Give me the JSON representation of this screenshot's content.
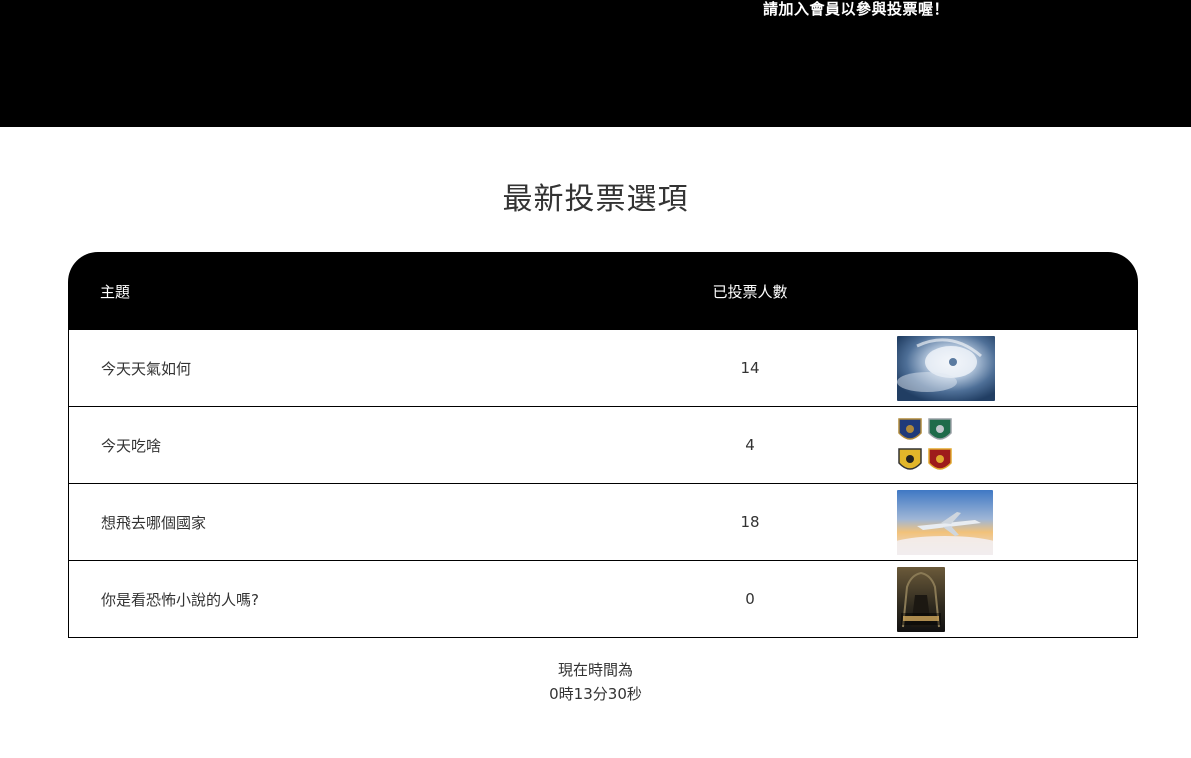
{
  "header": {
    "notice": "請加入會員以參與投票喔！"
  },
  "main": {
    "title": "最新投票選項",
    "table": {
      "headers": [
        "主題",
        "已投票人數",
        ""
      ],
      "rows": [
        {
          "topic": "今天天氣如何",
          "votes": "14",
          "image": "hurricane-satellite-image"
        },
        {
          "topic": "今天吃啥",
          "votes": "4",
          "image": "house-crests-image"
        },
        {
          "topic": "想飛去哪個國家",
          "votes": "18",
          "image": "airplane-sunset-image"
        },
        {
          "topic": "你是看恐怖小說的人嗎?",
          "votes": "0",
          "image": "horror-book-cover-image"
        }
      ]
    }
  },
  "footer": {
    "time_label": "現在時間為",
    "time_value": "0時13分30秒"
  }
}
